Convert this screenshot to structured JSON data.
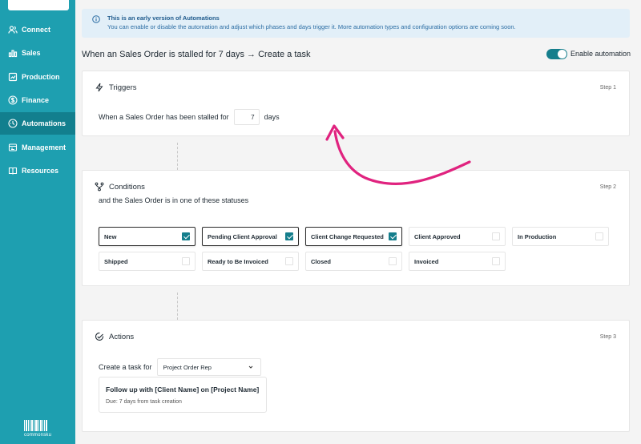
{
  "sidebar": {
    "items": [
      {
        "label": "Connect",
        "icon": "users-icon",
        "active": false
      },
      {
        "label": "Sales",
        "icon": "bar-chart-icon",
        "active": false
      },
      {
        "label": "Production",
        "icon": "production-icon",
        "active": false
      },
      {
        "label": "Finance",
        "icon": "dollar-icon",
        "active": false
      },
      {
        "label": "Automations",
        "icon": "automation-icon",
        "active": true
      },
      {
        "label": "Management",
        "icon": "management-icon",
        "active": false
      },
      {
        "label": "Resources",
        "icon": "book-icon",
        "active": false
      }
    ],
    "logo_text": "commonsku"
  },
  "notice": {
    "icon": "info-icon",
    "title": "This is an early version of Automations",
    "text": "You can enable or disable the automation and adjust which phases and days trigger it. More automation types and configuration options are coming soon."
  },
  "header": {
    "title": "When an Sales Order is stalled for 7 days → Create a task",
    "toggle_label": "Enable automation",
    "toggle_on": true
  },
  "triggers": {
    "title": "Triggers",
    "step": "Step 1",
    "prefix": "When a Sales Order has been stalled for",
    "days_value": "7",
    "suffix": "days"
  },
  "conditions": {
    "title": "Conditions",
    "step": "Step 2",
    "line": "and the Sales Order is in one of these statuses",
    "statuses": [
      {
        "label": "New",
        "checked": true
      },
      {
        "label": "Pending Client Approval",
        "checked": true
      },
      {
        "label": "Client Change Requested",
        "checked": true
      },
      {
        "label": "Client Approved",
        "checked": false
      },
      {
        "label": "In Production",
        "checked": false
      },
      {
        "label": "Shipped",
        "checked": false
      },
      {
        "label": "Ready to Be Invoiced",
        "checked": false
      },
      {
        "label": "Closed",
        "checked": false
      },
      {
        "label": "Invoiced",
        "checked": false
      }
    ]
  },
  "actions": {
    "title": "Actions",
    "step": "Step 3",
    "prefix": "Create a task for",
    "assignee": "Project Order Rep",
    "task_title": "Follow up with [Client Name] on [Project Name]",
    "task_due": "Due: 7 days from task creation"
  },
  "colors": {
    "sidebar": "#1e9fb0",
    "sidebar_active": "#127f8e",
    "accent": "#157e8c",
    "annotation_arrow": "#e0237f",
    "notice_bg": "#e2eff8"
  }
}
